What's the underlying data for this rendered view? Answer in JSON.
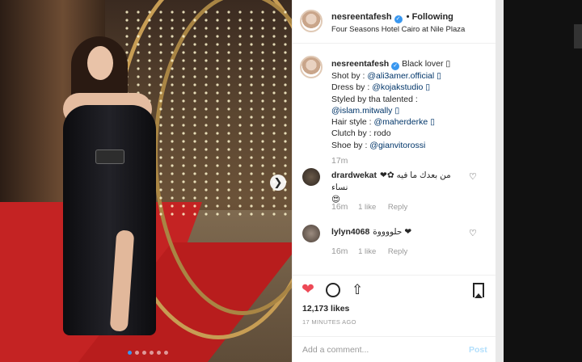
{
  "header": {
    "username": "nesreentafesh",
    "follow_label": "• Following",
    "location": "Four Seasons Hotel Cairo at Nile Plaza"
  },
  "caption": {
    "username": "nesreentafesh",
    "line1": "Black lover ▯",
    "shot_by_label": "Shot by : ",
    "shot_by": "@ali3amer.official ▯",
    "dress_by_label": "Dress by : ",
    "dress_by": "@kojakstudio ▯",
    "styled_label": "Styled by tha talented :",
    "styled_by": "@islam.mitwally ▯",
    "hair_label": "Hair style : ",
    "hair_by": "@maherderke ▯",
    "clutch": "Clutch by : rodo",
    "shoe_label": "Shoe by : ",
    "shoe_by": "@gianvitorossi",
    "time": "17m"
  },
  "comments": [
    {
      "username": "drardwekat",
      "text": "❤✿ من بعدك ما فيه نساء",
      "emoji": "😍",
      "time": "16m",
      "likes": "1 like",
      "reply": "Reply"
    },
    {
      "username": "lylyn4068",
      "text": "حلووووة ❤",
      "emoji": "",
      "time": "16m",
      "likes": "1 like",
      "reply": "Reply"
    }
  ],
  "actions": {
    "likes": "12,173 likes",
    "post_time": "17 MINUTES AGO",
    "add_comment_placeholder": "Add a comment...",
    "post_label": "Post"
  },
  "icons": {
    "next": "chevron-right-icon",
    "like": "heart-icon",
    "comment": "comment-icon",
    "share": "share-icon",
    "save": "bookmark-icon"
  },
  "colors": {
    "like_red": "#ed4956",
    "link_blue": "#003569",
    "post_disabled": "#b2dffc",
    "carousel_active": "#3897f0"
  },
  "carousel": {
    "count": 6,
    "active": 1
  }
}
